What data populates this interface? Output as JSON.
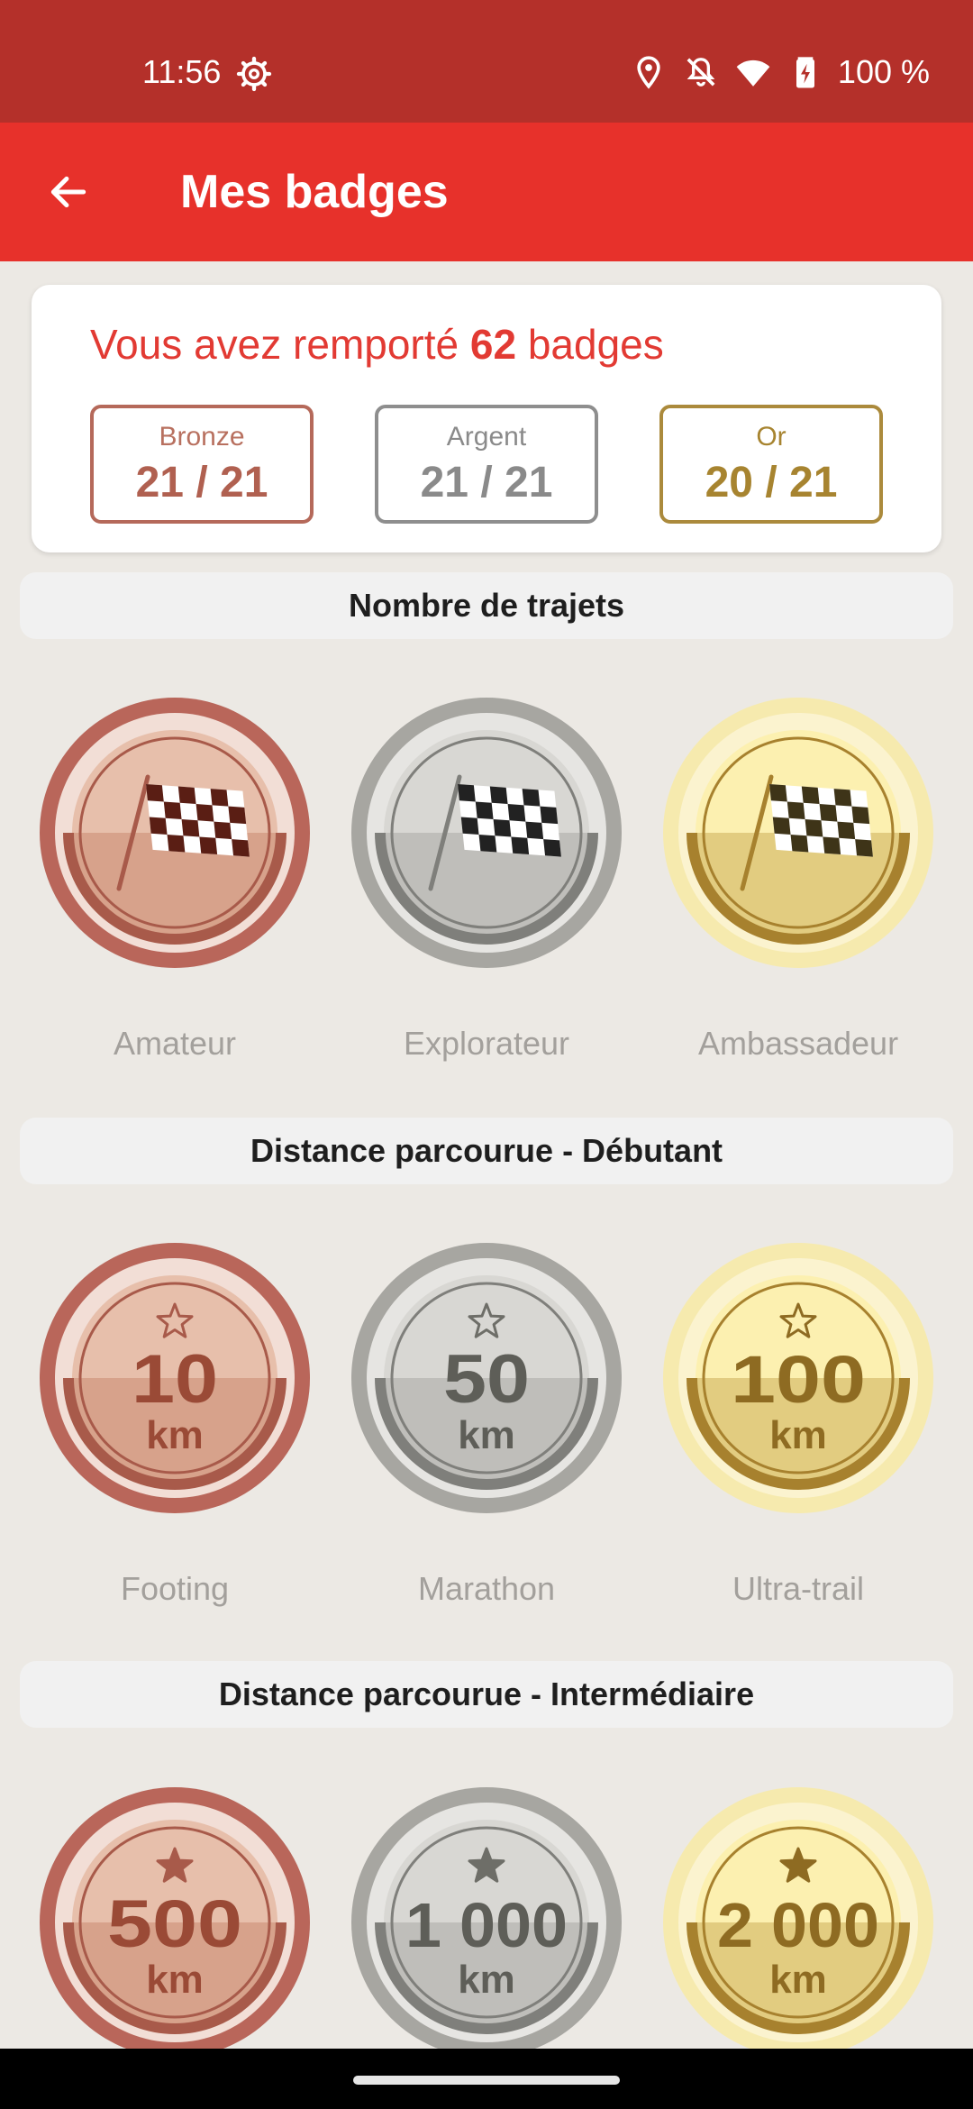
{
  "status_bar": {
    "time": "11:56",
    "battery": "100 %",
    "icons": [
      "settings-gear-icon",
      "location-pin-icon",
      "bell-off-icon",
      "wifi-icon",
      "battery-charging-icon"
    ]
  },
  "app_bar": {
    "title": "Mes badges",
    "back_icon": "arrow-left-icon"
  },
  "summary": {
    "prefix": "Vous avez remporté ",
    "count": "62",
    "suffix": " badges",
    "tiers": [
      {
        "label": "Bronze",
        "count": "21 / 21",
        "color": "#B5695A"
      },
      {
        "label": "Argent",
        "count": "21 / 21",
        "color": "#8E8E8E"
      },
      {
        "label": "Or",
        "count": "20 / 21",
        "color": "#AB8A3C"
      }
    ]
  },
  "sections": [
    {
      "title": "Nombre de trajets",
      "badges": [
        {
          "label": "Amateur",
          "tier": "bronze",
          "icon": "checkered-flag-icon"
        },
        {
          "label": "Explorateur",
          "tier": "silver",
          "icon": "checkered-flag-icon"
        },
        {
          "label": "Ambassadeur",
          "tier": "gold",
          "icon": "checkered-flag-icon"
        }
      ]
    },
    {
      "title": "Distance parcourue - Débutant",
      "badges": [
        {
          "label": "Footing",
          "tier": "bronze",
          "icon": "star-outline-icon",
          "value": "10",
          "unit": "km"
        },
        {
          "label": "Marathon",
          "tier": "silver",
          "icon": "star-outline-icon",
          "value": "50",
          "unit": "km"
        },
        {
          "label": "Ultra-trail",
          "tier": "gold",
          "icon": "star-outline-icon",
          "value": "100",
          "unit": "km"
        }
      ]
    },
    {
      "title": "Distance parcourue - Intermédiaire",
      "badges": [
        {
          "label": "",
          "tier": "bronze",
          "icon": "star-filled-icon",
          "value": "500",
          "unit": "km"
        },
        {
          "label": "",
          "tier": "silver",
          "icon": "star-filled-icon",
          "value": "1 000",
          "unit": "km"
        },
        {
          "label": "",
          "tier": "gold",
          "icon": "star-filled-icon",
          "value": "2 000",
          "unit": "km"
        }
      ]
    }
  ],
  "colors": {
    "status_bar": "#B4302A",
    "app_bar": "#E7312B",
    "accent_text": "#E23A33",
    "background": "#ECE9E4"
  }
}
